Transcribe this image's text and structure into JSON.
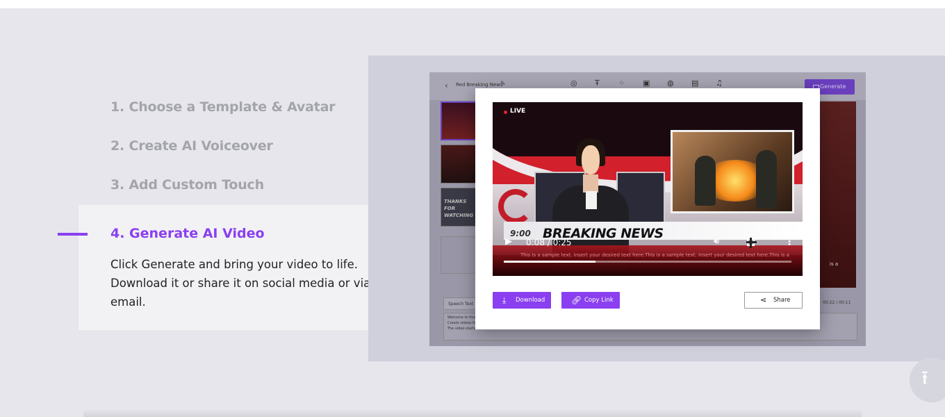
{
  "steps": [
    {
      "label": "1. Choose a Template & Avatar"
    },
    {
      "label": "2. Create AI Voiceover"
    },
    {
      "label": "3. Add Custom Touch"
    }
  ],
  "active_step": {
    "title": "4. Generate AI Video",
    "description": "Click Generate and bring your video to life. Download it or share it on social media or via email."
  },
  "editor": {
    "project_name": "Red Breaking News",
    "generate_label": "Generate",
    "thumb3_text": "THANKS FOR WATCHING",
    "speech_tab": "Speech Text",
    "speech_lines": [
      "Welcome to this p",
      "Create videos fo",
      "The video starts fr"
    ],
    "time_readout": "00:22 / 00:11",
    "side_text": "is a"
  },
  "modal": {
    "live_label": "LIVE",
    "headline_time": "9:00",
    "headline": "BREAKING NEWS",
    "ticker": "This is a sample text. Insert your desired text here.This is a sample text. Insert your desired text here.This is a",
    "player_time": "0:08 / 0:25",
    "progress_fraction": 0.32,
    "download_label": "Download",
    "copy_link_label": "Copy Link",
    "share_label": "Share"
  },
  "colors": {
    "accent": "#8a3ff0",
    "background": "#e6e6ec"
  }
}
